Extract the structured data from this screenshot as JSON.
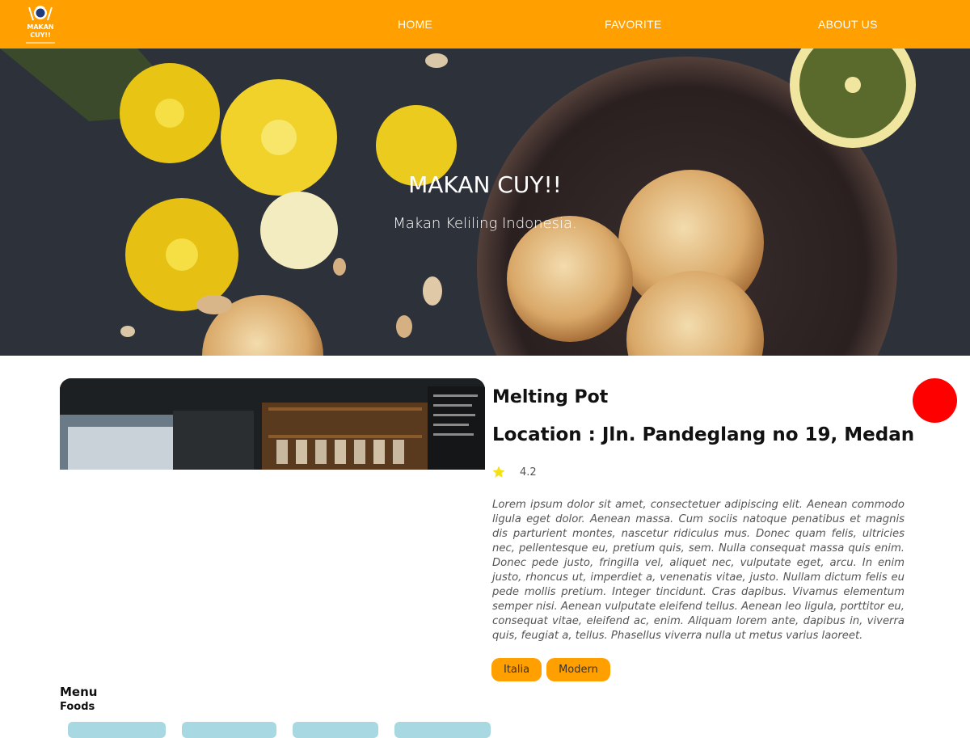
{
  "nav": {
    "logo_text": "MAKAN CUY!!",
    "links": [
      {
        "label": "HOME"
      },
      {
        "label": "FAVORITE"
      },
      {
        "label": "ABOUT US"
      }
    ]
  },
  "hero": {
    "title": "MAKAN CUY!!",
    "subtitle": "Makan Keliling Indonesia."
  },
  "restaurant": {
    "name": "Melting Pot",
    "location": "Location : Jln. Pandeglang no 19, Medan",
    "rating": "4.2",
    "description": "Lorem ipsum dolor sit amet, consectetuer adipiscing elit. Aenean commodo ligula eget dolor. Aenean massa. Cum sociis natoque penatibus et magnis dis parturient montes, nascetur ridiculus mus. Donec quam felis, ultricies nec, pellentesque eu, pretium quis, sem. Nulla consequat massa quis enim. Donec pede justo, fringilla vel, aliquet nec, vulputate eget, arcu. In enim justo, rhoncus ut, imperdiet a, venenatis vitae, justo. Nullam dictum felis eu pede mollis pretium. Integer tincidunt. Cras dapibus. Vivamus elementum semper nisi. Aenean vulputate eleifend tellus. Aenean leo ligula, porttitor eu, consequat vitae, eleifend ac, enim. Aliquam lorem ante, dapibus in, viverra quis, feugiat a, tellus. Phasellus viverra nulla ut metus varius laoreet.",
    "categories": [
      {
        "label": "Italia"
      },
      {
        "label": "Modern"
      }
    ]
  },
  "menu": {
    "title": "Menu",
    "foods_label": "Foods"
  },
  "colors": {
    "brand": "#ff9f00",
    "fab": "#ff0000",
    "food_card": "#a8d8e2"
  },
  "icons": {
    "rating": "star-icon",
    "logo": "chef-logo-icon"
  }
}
